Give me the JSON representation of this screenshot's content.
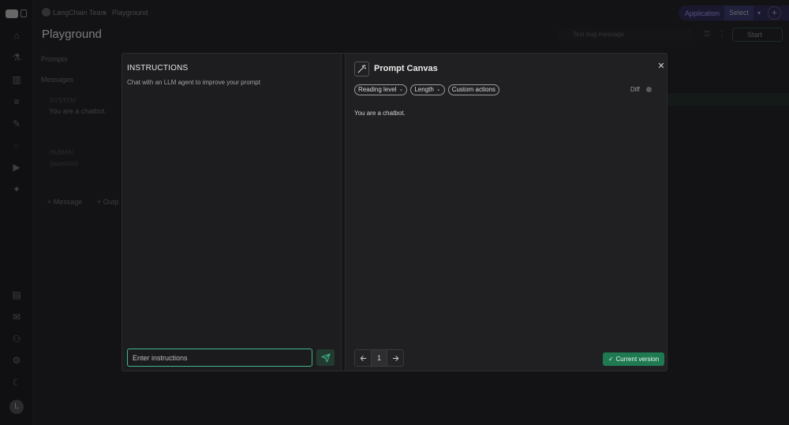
{
  "topbar": {
    "breadcrumb_team": "LangChain Team",
    "breadcrumb_sep": "›",
    "breadcrumb_page": "Playground",
    "app_label": "Application",
    "app_select": "Select",
    "page_title": "Playground",
    "message_select_placeholder": "Test bug message",
    "start_label": "Start"
  },
  "background": {
    "prompts_label": "Prompts",
    "messages_label": "Messages",
    "role_1": "SYSTEM",
    "message_1": "You are a chatbot.",
    "role_2": "HUMAN",
    "message_2": "{question}",
    "add_message": "+ Message",
    "add_output": "+ Outp"
  },
  "instructions": {
    "title": "INSTRUCTIONS",
    "subtitle": "Chat with an LLM agent to improve your prompt",
    "input_placeholder": "Enter instructions"
  },
  "canvas": {
    "title": "Prompt Canvas",
    "chips": [
      "Reading level",
      "Length",
      "Custom actions"
    ],
    "diff_label": "Diff",
    "prompt_text": "You are a chatbot.",
    "page_number": "1",
    "version_label": "Current version"
  },
  "colors": {
    "accent_green": "#1f7a52",
    "input_focus": "#3fb88a",
    "app_purple": "#2a2650"
  },
  "icons": {
    "sidebar": [
      "home-icon",
      "flask-icon",
      "chart-icon",
      "database-icon",
      "pencil-icon",
      "chat-icon",
      "play-icon",
      "sparkle-icon",
      "clipboard-icon",
      "mail-icon",
      "users-icon",
      "gear-icon",
      "moon-icon"
    ]
  }
}
